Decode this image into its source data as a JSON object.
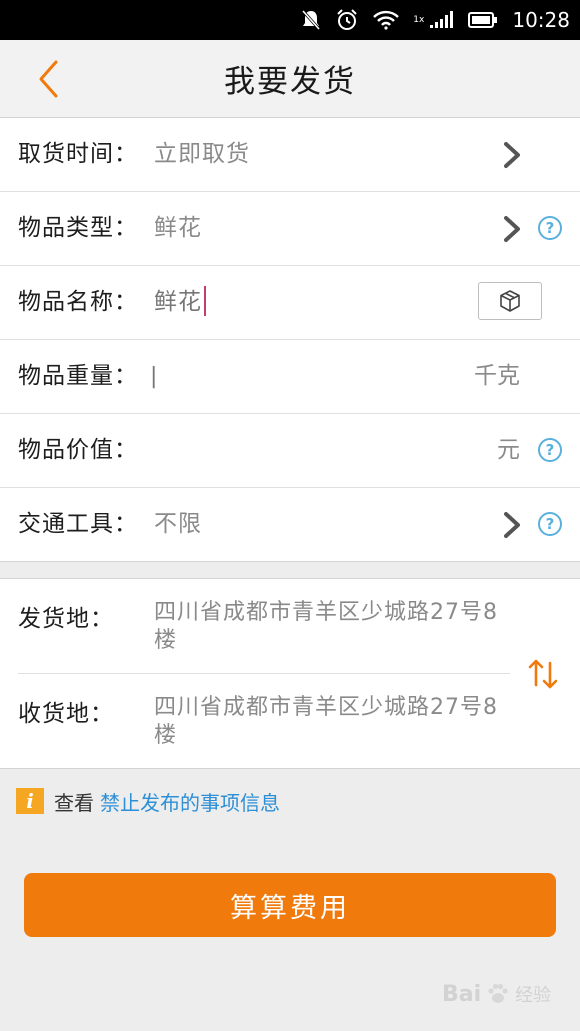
{
  "status_bar": {
    "time": "10:28",
    "network_label": "1x",
    "icons": [
      "mute-icon",
      "alarm-icon",
      "wifi-icon",
      "signal-icon",
      "battery-icon"
    ]
  },
  "header": {
    "title": "我要发货",
    "back_icon": "chevron-left-icon"
  },
  "form": {
    "pickup_time": {
      "label": "取货时间：",
      "value": "立即取货"
    },
    "item_type": {
      "label": "物品类型：",
      "value": "鲜花"
    },
    "item_name": {
      "label": "物品名称：",
      "value": "鲜花"
    },
    "item_weight": {
      "label": "物品重量：",
      "value": "",
      "cursor_text": "|",
      "unit": "千克"
    },
    "item_value": {
      "label": "物品价值：",
      "value": "",
      "unit": "元"
    },
    "transport": {
      "label": "交通工具：",
      "value": "不限"
    },
    "help_symbol": "?"
  },
  "address": {
    "from": {
      "label": "发货地：",
      "value": "四川省成都市青羊区少城路27号8楼"
    },
    "to": {
      "label": "收货地：",
      "value": "四川省成都市青羊区少城路27号8楼"
    }
  },
  "notice": {
    "badge": "i",
    "prefix": "查看",
    "link_text": "禁止发布的事项信息"
  },
  "actions": {
    "calculate_label": "算算费用"
  },
  "watermark": {
    "brand": "Bai",
    "suffix": "经验"
  },
  "colors": {
    "accent": "#f07a0c",
    "link": "#2d8fd6",
    "help": "#5ab0dc",
    "info_badge": "#f5a623"
  }
}
